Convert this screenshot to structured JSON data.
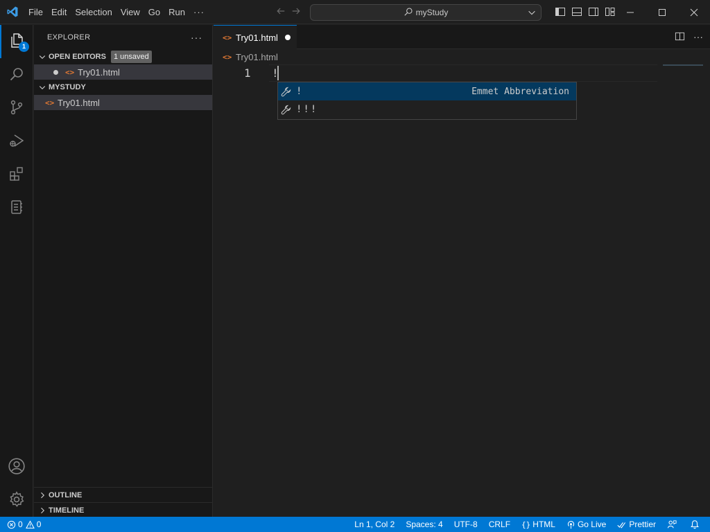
{
  "titlebar": {
    "menu": [
      "File",
      "Edit",
      "Selection",
      "View",
      "Go",
      "Run"
    ],
    "menu_more": "···",
    "search_text": "myStudy"
  },
  "activitybar": {
    "explorer_badge": "1",
    "items": [
      "files-icon",
      "search-icon",
      "source-control-icon",
      "run-debug-icon",
      "extensions-icon",
      "notebook-icon",
      "account-icon",
      "settings-gear-icon"
    ]
  },
  "sidebar": {
    "title": "EXPLORER",
    "more": "···",
    "open_editors": {
      "label": "OPEN EDITORS",
      "badge": "1 unsaved",
      "file": "Try01.html"
    },
    "folder": {
      "label": "MYSTUDY",
      "file": "Try01.html"
    },
    "outline": "OUTLINE",
    "timeline": "TIMELINE"
  },
  "editor": {
    "tab": "Try01.html",
    "breadcrumb": "Try01.html",
    "line_number": "1",
    "code": "!",
    "suggestions": [
      {
        "label": "!",
        "detail": "Emmet Abbreviation",
        "selected": true
      },
      {
        "label": "!!!",
        "detail": "",
        "selected": false
      }
    ],
    "actions_more": "···"
  },
  "statusbar": {
    "errors": "0",
    "warnings": "0",
    "position": "Ln 1, Col 2",
    "spaces": "Spaces: 4",
    "encoding": "UTF-8",
    "eol": "CRLF",
    "language": "HTML",
    "golive": "Go Live",
    "prettier": "Prettier"
  },
  "colors": {
    "accent": "#0078d4",
    "html_icon": "#e37933",
    "suggest_highlight": "#2aaaff"
  }
}
